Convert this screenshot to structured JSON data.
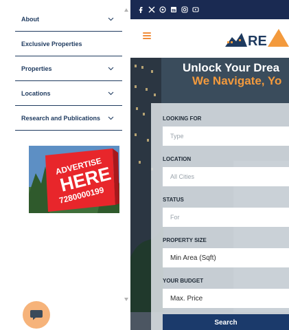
{
  "drawer": {
    "items": [
      {
        "label": "About",
        "has_submenu": true
      },
      {
        "label": "Exclusive Properties",
        "has_submenu": false
      },
      {
        "label": "Properties",
        "has_submenu": true
      },
      {
        "label": "Locations",
        "has_submenu": true
      },
      {
        "label": "Research and Publications",
        "has_submenu": true
      }
    ],
    "advert": {
      "line1": "ADVERTISE",
      "line2": "HERE",
      "phone": "7280000199"
    }
  },
  "header": {
    "logo_text": "RE"
  },
  "hero": {
    "title": "Unlock Your Drea",
    "subtitle": "We Navigate, Yo"
  },
  "search_form": {
    "fields": [
      {
        "label": "LOOKING FOR",
        "placeholder": "Type"
      },
      {
        "label": "LOCATION",
        "placeholder": "All Cities"
      },
      {
        "label": "STATUS",
        "placeholder": "For"
      },
      {
        "label": "PROPERTY SIZE",
        "value": "Min Area (Sqft)"
      },
      {
        "label": "YOUR BUDGET",
        "value": "Max. Price"
      }
    ],
    "submit_label": "Search"
  },
  "colors": {
    "navy": "#1e3a5f",
    "topbar": "#1a2a52",
    "accent_orange": "#f39a3d",
    "button": "#1b3a6b",
    "chat_bubble": "#f6b37a"
  },
  "icons": {
    "social": [
      "facebook-icon",
      "x-icon",
      "whatsapp-icon",
      "linkedin-icon",
      "instagram-icon",
      "youtube-icon"
    ],
    "chevron": "chevron-down-icon",
    "menu": "hamburger-icon",
    "chat": "chat-icon"
  }
}
